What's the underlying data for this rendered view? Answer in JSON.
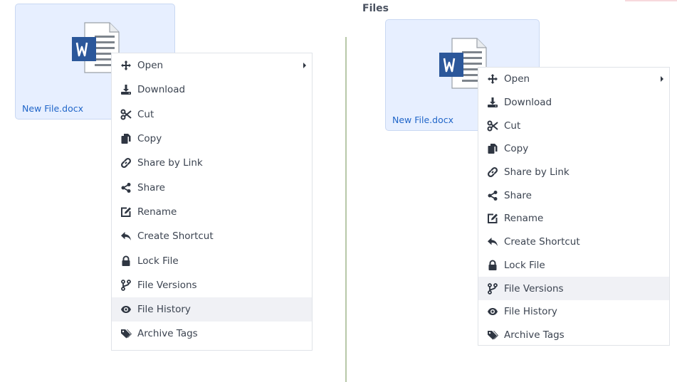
{
  "right_panel": {
    "section_title": "Files"
  },
  "file": {
    "name": "New File.docx",
    "icon": "word-document-icon"
  },
  "menu": {
    "items": [
      {
        "label": "Open",
        "icon": "move-arrows-icon",
        "has_submenu": true
      },
      {
        "label": "Download",
        "icon": "download-icon"
      },
      {
        "label": "Cut",
        "icon": "scissors-icon"
      },
      {
        "label": "Copy",
        "icon": "copy-icon"
      },
      {
        "label": "Share by Link",
        "icon": "link-icon"
      },
      {
        "label": "Share",
        "icon": "share-icon"
      },
      {
        "label": "Rename",
        "icon": "rename-icon"
      },
      {
        "label": "Create Shortcut",
        "icon": "reply-arrow-icon"
      },
      {
        "label": "Lock File",
        "icon": "lock-icon"
      },
      {
        "label": "File Versions",
        "icon": "branch-icon"
      },
      {
        "label": "File History",
        "icon": "eye-icon"
      },
      {
        "label": "Archive Tags",
        "icon": "tags-icon"
      }
    ],
    "left_highlighted": "File History",
    "right_highlighted": "File Versions"
  },
  "colors": {
    "card_background": "#e7efff",
    "file_name": "#2166c9",
    "word_blue": "#2b579a",
    "highlight": "#f0f1f5"
  }
}
